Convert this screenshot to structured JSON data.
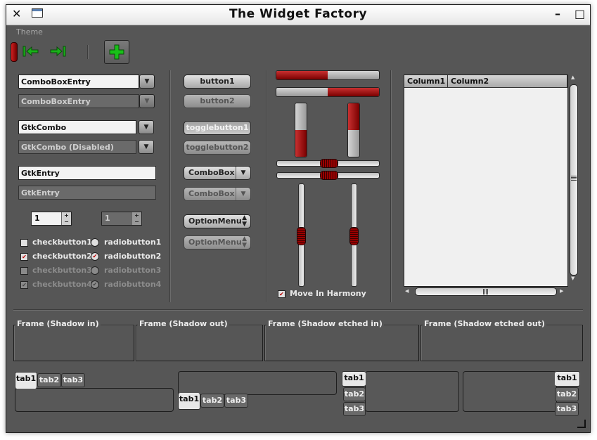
{
  "window": {
    "title": "The Widget Factory",
    "close_glyph": "✕",
    "minimize_glyph": "–",
    "maximize_glyph": "□"
  },
  "menubar": {
    "items": [
      "Theme"
    ]
  },
  "toolbar": {
    "icons": [
      "stop-icon",
      "go-back-icon",
      "go-forward-icon",
      "add-icon"
    ],
    "accent_red": "#a00000",
    "accent_green": "#19b019"
  },
  "left": {
    "combo1": "ComboBoxEntry",
    "combo2": "ComboBoxEntry",
    "combo3": "GtkCombo",
    "combo4": "GtkCombo (Disabled)",
    "entry1": "GtkEntry",
    "entry2": "GtkEntry",
    "spin1": "1",
    "spin2": "1",
    "check1": "checkbutton1",
    "check2": "checkbutton2",
    "check3": "checkbutton3",
    "check4": "checkbutton4",
    "radio1": "radiobutton1",
    "radio2": "radiobutton2",
    "radio3": "radiobutton3",
    "radio4": "radiobutton4"
  },
  "buttons": {
    "button1": "button1",
    "button2": "button2",
    "toggle1": "togglebutton1",
    "toggle2": "togglebutton2",
    "combobox1": "ComboBox",
    "combobox2": "ComboBox",
    "option1": "OptionMenu",
    "option2": "OptionMenu"
  },
  "ranges": {
    "progress_h1": 0.5,
    "progress_h2": 0.5,
    "progress_v1": 0.5,
    "progress_v2": 0.5,
    "scale_h1": 0.5,
    "scale_h2": 0.5,
    "scale_v1": 0.5,
    "scale_v2": 0.5,
    "harmony_label": "Move In Harmony"
  },
  "list": {
    "columns": [
      "Column1",
      "Column2"
    ]
  },
  "frames": [
    "Frame (Shadow in)",
    "Frame (Shadow out)",
    "Frame (Shadow etched in)",
    "Frame (Shadow etched out)"
  ],
  "tabs": {
    "set1": [
      "tab1",
      "tab2",
      "tab3"
    ],
    "set2": [
      "tab1",
      "tab2",
      "tab3"
    ],
    "set3": [
      "tab1",
      "tab2",
      "tab3"
    ],
    "set4": [
      "tab1",
      "tab2",
      "tab3"
    ]
  }
}
